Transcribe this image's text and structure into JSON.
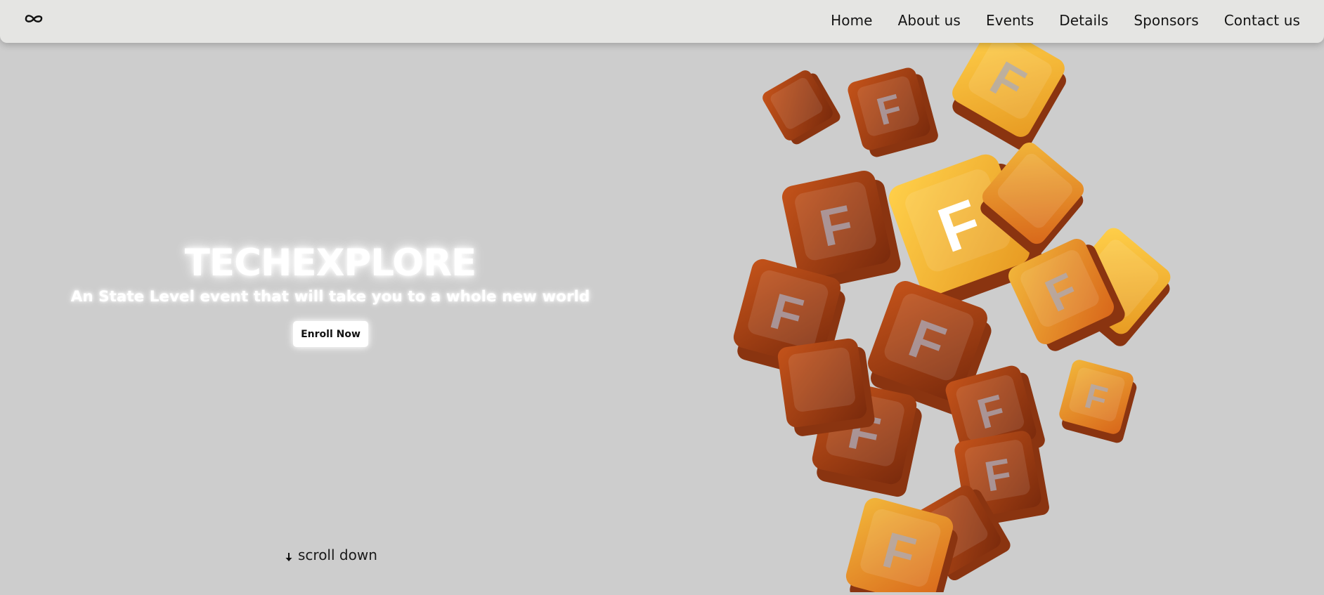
{
  "navbar": {
    "logo_icon": "infinity-icon",
    "links": [
      {
        "label": "Home"
      },
      {
        "label": "About us"
      },
      {
        "label": "Events"
      },
      {
        "label": "Details"
      },
      {
        "label": "Sponsors"
      },
      {
        "label": "Contact us"
      }
    ]
  },
  "hero": {
    "title": "TECHEXPLORE",
    "subtitle": "An State Level event that will take you to a whole new world",
    "cta_label": "Enroll Now",
    "scroll_label": "scroll down",
    "scroll_icon": "arrow-down-icon",
    "image_icon": "keyboard-keys-image",
    "key_letter": "F"
  },
  "colors": {
    "background": "#cdcdcd",
    "navbar": "#e5e5e3",
    "key_dark": "#8a3410",
    "key_mid": "#cf5a14",
    "key_light": "#f1b52e",
    "text_dark": "#141414",
    "text_light": "#ffffff"
  }
}
